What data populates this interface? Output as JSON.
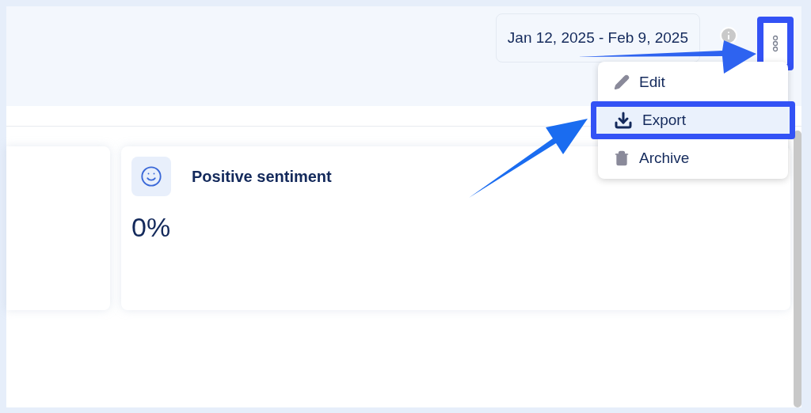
{
  "header": {
    "date_range": "Jan 12, 2025 - Feb 9, 2025"
  },
  "menu": {
    "items": [
      {
        "kind": "edit",
        "label": "Edit",
        "selected": false
      },
      {
        "kind": "export",
        "label": "Export",
        "selected": true
      },
      {
        "kind": "archive",
        "label": "Archive",
        "selected": false
      }
    ]
  },
  "cards": [
    {
      "kind": "blank"
    },
    {
      "kind": "metric",
      "title": "Positive sentiment",
      "value": "0%"
    }
  ]
}
